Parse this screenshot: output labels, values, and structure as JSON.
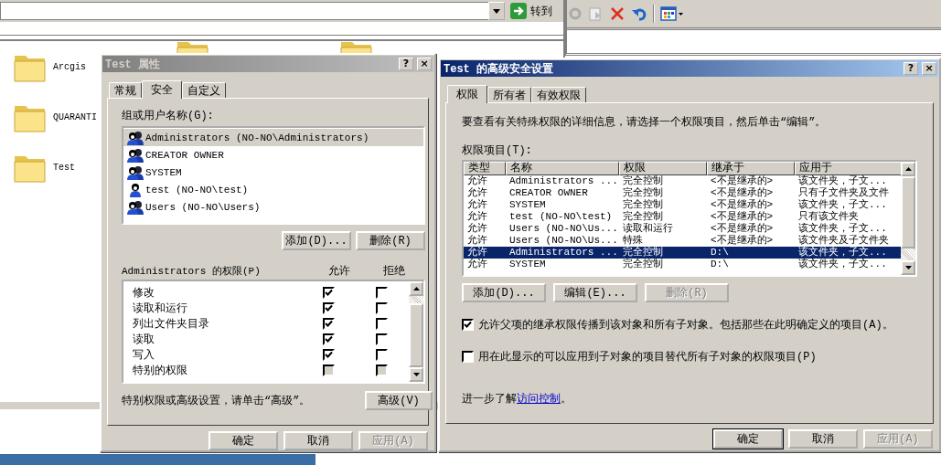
{
  "explorer": {
    "go_label": "转到",
    "folders": [
      {
        "name": "Arcgis"
      },
      {
        "name": "QUARANTI"
      },
      {
        "name": "Test"
      }
    ]
  },
  "properties": {
    "title": "Test 属性",
    "active": false,
    "title_buttons": [
      {
        "kind": "help",
        "label": "?"
      },
      {
        "kind": "close",
        "label": "×"
      }
    ],
    "tabs": [
      {
        "label": "常规",
        "selected": false
      },
      {
        "label": "安全",
        "selected": true
      },
      {
        "label": "自定义",
        "selected": false
      }
    ],
    "users_label": "组或用户名称(G):",
    "users": [
      {
        "name": "Administrators (NO-NO\\Administrators)",
        "kind": "group",
        "selected": true
      },
      {
        "name": "CREATOR OWNER",
        "kind": "group",
        "selected": false
      },
      {
        "name": "SYSTEM",
        "kind": "group",
        "selected": false
      },
      {
        "name": "test (NO-NO\\test)",
        "kind": "user",
        "selected": false
      },
      {
        "name": "Users (NO-NO\\Users)",
        "kind": "group",
        "selected": false
      }
    ],
    "user_buttons": [
      "添加(D)...",
      "删除(R)"
    ],
    "perm_label": "Administrators 的权限(P)",
    "allow_header": "允许",
    "deny_header": "拒绝",
    "permissions": [
      {
        "name": "修改",
        "allow": true,
        "deny": false,
        "disabled": false
      },
      {
        "name": "读取和运行",
        "allow": true,
        "deny": false,
        "disabled": false
      },
      {
        "name": "列出文件夹目录",
        "allow": true,
        "deny": false,
        "disabled": false
      },
      {
        "name": "读取",
        "allow": true,
        "deny": false,
        "disabled": false
      },
      {
        "name": "写入",
        "allow": true,
        "deny": false,
        "disabled": false
      },
      {
        "name": "特别的权限",
        "allow": false,
        "deny": false,
        "disabled": true
      }
    ],
    "hint": "特别权限或高级设置，请单击“高级”。",
    "advanced_button": "高级(V)",
    "footer": [
      {
        "label": "确定",
        "disabled": false,
        "default": false
      },
      {
        "label": "取消",
        "disabled": false,
        "default": false
      },
      {
        "label": "应用(A)",
        "disabled": true,
        "default": false
      }
    ]
  },
  "advanced": {
    "title": "Test 的高级安全设置",
    "active": true,
    "title_buttons": [
      {
        "kind": "help",
        "label": "?"
      },
      {
        "kind": "close",
        "label": "×"
      }
    ],
    "tabs": [
      {
        "label": "权限",
        "selected": true
      },
      {
        "label": "所有者",
        "selected": false
      },
      {
        "label": "有效权限",
        "selected": false
      }
    ],
    "intro": "要查看有关特殊权限的详细信息，请选择一个权限项目，然后单击“编辑”。",
    "list_label": "权限项目(T):",
    "columns": [
      "类型",
      "名称",
      "权限",
      "继承于",
      "应用于"
    ],
    "rows": [
      {
        "type": "允许",
        "name": "Administrators ...",
        "permission": "完全控制",
        "inherited_from": "<不是继承的>",
        "applies_to": "该文件夹，子文...",
        "selected": false
      },
      {
        "type": "允许",
        "name": "CREATOR OWNER",
        "permission": "完全控制",
        "inherited_from": "<不是继承的>",
        "applies_to": "只有子文件夹及文件",
        "selected": false
      },
      {
        "type": "允许",
        "name": "SYSTEM",
        "permission": "完全控制",
        "inherited_from": "<不是继承的>",
        "applies_to": "该文件夹，子文...",
        "selected": false
      },
      {
        "type": "允许",
        "name": "test (NO-NO\\test)",
        "permission": "完全控制",
        "inherited_from": "<不是继承的>",
        "applies_to": "只有该文件夹",
        "selected": false
      },
      {
        "type": "允许",
        "name": "Users (NO-NO\\Us...",
        "permission": "读取和运行",
        "inherited_from": "<不是继承的>",
        "applies_to": "该文件夹，子文...",
        "selected": false
      },
      {
        "type": "允许",
        "name": "Users (NO-NO\\Us...",
        "permission": "特殊",
        "inherited_from": "<不是继承的>",
        "applies_to": "该文件夹及子文件夹",
        "selected": false
      },
      {
        "type": "允许",
        "name": "Administrators ...",
        "permission": "完全控制",
        "inherited_from": "D:\\",
        "applies_to": "该文件夹，子文...",
        "selected": true
      },
      {
        "type": "允许",
        "name": "SYSTEM",
        "permission": "完全控制",
        "inherited_from": "D:\\",
        "applies_to": "该文件夹，子文...",
        "selected": false
      }
    ],
    "buttons": [
      {
        "label": "添加(D)...",
        "disabled": false
      },
      {
        "label": "编辑(E)...",
        "disabled": false
      },
      {
        "label": "删除(R)",
        "disabled": true
      }
    ],
    "options": [
      {
        "label": "允许父项的继承权限传播到该对象和所有子对象。包括那些在此明确定义的项目(A)。",
        "checked": true
      },
      {
        "label": "用在此显示的可以应用到子对象的项目替代所有子对象的权限项目(P)",
        "checked": false
      }
    ],
    "learn_more": {
      "text": "进一步了解",
      "link": "访问控制",
      "end": "。"
    },
    "footer": [
      {
        "label": "确定",
        "disabled": false,
        "default": true
      },
      {
        "label": "取消",
        "disabled": false,
        "default": false
      },
      {
        "label": "应用(A)",
        "disabled": true,
        "default": false
      }
    ]
  }
}
